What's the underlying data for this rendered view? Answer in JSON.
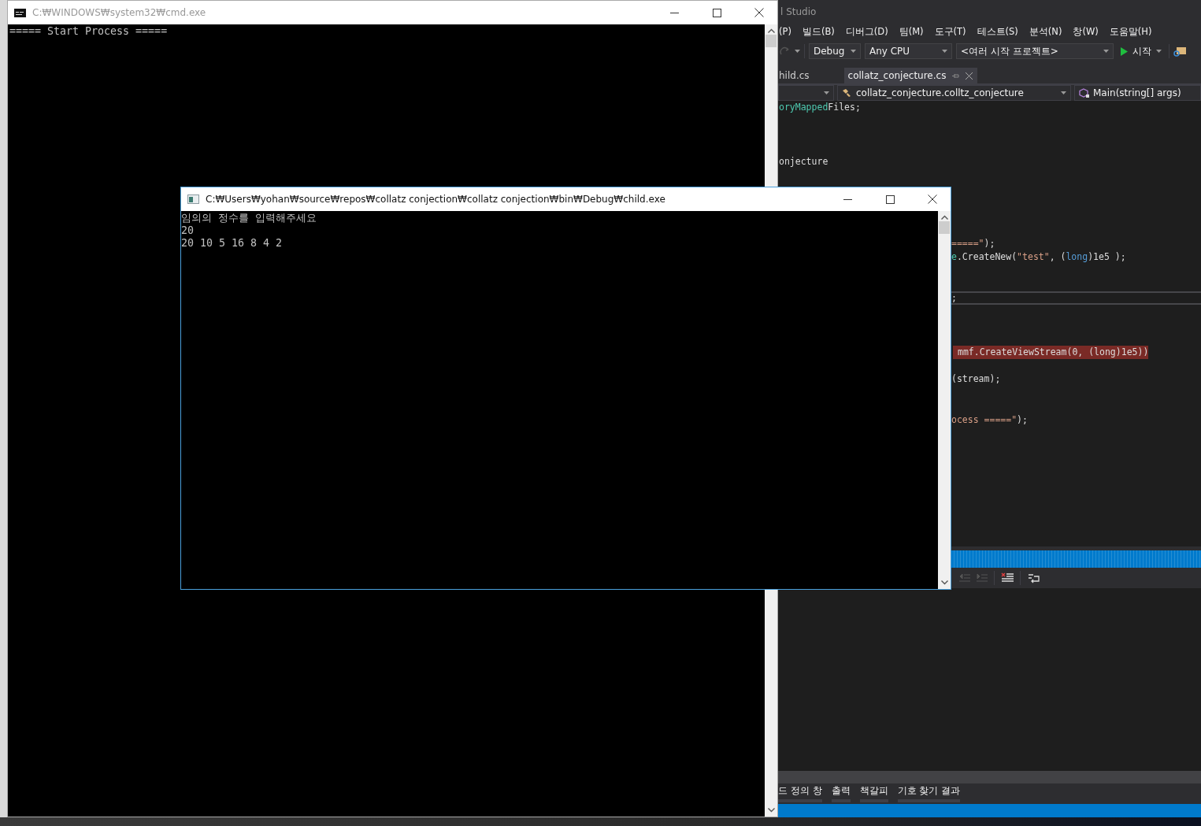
{
  "cmd_window": {
    "title": "C:₩WINDOWS₩system32₩cmd.exe",
    "output_lines": [
      "===== Start Process ====="
    ]
  },
  "child_window": {
    "title": "C:₩Users₩yohan₩source₩repos₩collatz conjection₩collatz conjection₩bin₩Debug₩child.exe",
    "output_lines": [
      "임의의 정수를 입력해주세요",
      "20",
      "20 10 5 16 8 4 2"
    ]
  },
  "visual_studio": {
    "title": "l Studio",
    "menu": [
      "(P)",
      "빌드(B)",
      "디버그(D)",
      "팀(M)",
      "도구(T)",
      "테스트(S)",
      "분석(N)",
      "창(W)",
      "도움말(H)"
    ],
    "toolbar": {
      "configuration": "Debug",
      "platform": "Any CPU",
      "startup_project": "<여러 시작 프로젝트>",
      "start_button": "시작"
    },
    "tabs": [
      {
        "label": "hild.cs",
        "selected": false
      },
      {
        "label": "collatz_conjecture.cs",
        "selected": true
      }
    ],
    "navigation": {
      "type_dropdown": "collatz_conjecture.colltz_conjecture",
      "member_dropdown": "Main(string[] args)"
    },
    "code_lines": [
      {
        "breakpoint": false,
        "current": false,
        "segments": [
          {
            "text": "oryMapped",
            "kind": "type"
          },
          {
            "text": "Files;",
            "kind": "plain"
          }
        ]
      },
      {
        "breakpoint": false,
        "current": false,
        "segments": [
          {
            "text": "onjecture",
            "kind": "plain"
          }
        ]
      },
      {
        "breakpoint": false,
        "current": false,
        "segments": [
          {
            "text": "=====\"",
            "kind": "string"
          },
          {
            "text": ");",
            "kind": "plain"
          }
        ]
      },
      {
        "breakpoint": false,
        "current": false,
        "segments": [
          {
            "text": "e",
            "kind": "type"
          },
          {
            "text": ".CreateNew(",
            "kind": "plain"
          },
          {
            "text": "\"test\"",
            "kind": "string"
          },
          {
            "text": ", (",
            "kind": "plain"
          },
          {
            "text": "long",
            "kind": "keyword"
          },
          {
            "text": ")1e5 );",
            "kind": "plain"
          }
        ]
      },
      {
        "breakpoint": false,
        "current": true,
        "segments": [
          {
            "text": ";",
            "kind": "plain"
          }
        ]
      },
      {
        "breakpoint": true,
        "current": false,
        "segments": [
          {
            "text": "mmf.CreateViewStream(0, (long)1e5))",
            "kind": "plain"
          }
        ]
      },
      {
        "breakpoint": false,
        "current": false,
        "segments": [
          {
            "text": "(stream);",
            "kind": "plain"
          }
        ]
      },
      {
        "breakpoint": false,
        "current": false,
        "segments": [
          {
            "text": "ocess =====\"",
            "kind": "string"
          },
          {
            "text": ");",
            "kind": "plain"
          }
        ]
      }
    ],
    "bottom_tabs": [
      "드 정의 창",
      "출력",
      "책갈피",
      "기호 찾기 결과"
    ]
  }
}
